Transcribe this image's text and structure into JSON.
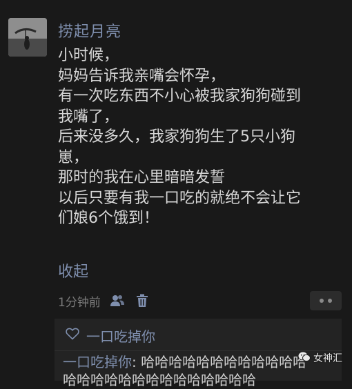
{
  "post": {
    "username": "捞起月亮",
    "content_lines": [
      "小时候，",
      "妈妈告诉我亲嘴会怀孕，",
      "有一次吃东西不小心被我家狗狗碰到",
      "我嘴了，",
      "后来没多久，我家狗狗生了5只小狗",
      "崽，",
      "那时的我在心里暗暗发誓",
      "以后只要有我一口吃的就绝不会让它",
      "们娘6个饿到！"
    ],
    "collapse_label": "收起",
    "timestamp": "1分钟前",
    "icons": {
      "friends": "people-icon",
      "delete": "trash-icon",
      "more": "more-dots-icon",
      "like": "heart-outline-icon"
    }
  },
  "likes": {
    "names": "一口吃掉你"
  },
  "comment": {
    "author": "一口吃掉你",
    "separator": ":",
    "text": " 哈哈哈哈哈哈哈哈哈哈哈哈",
    "overflow_text": "哈哈哈哈哈哈哈哈哈哈哈哈哈哈"
  },
  "watermark": {
    "text": "女神汇",
    "icon": "wechat-icon"
  },
  "colors": {
    "background": "#191919",
    "link_blue": "#7f8fae",
    "text": "#d8d8d8",
    "muted": "#7a7a7a",
    "panel": "#232323"
  }
}
